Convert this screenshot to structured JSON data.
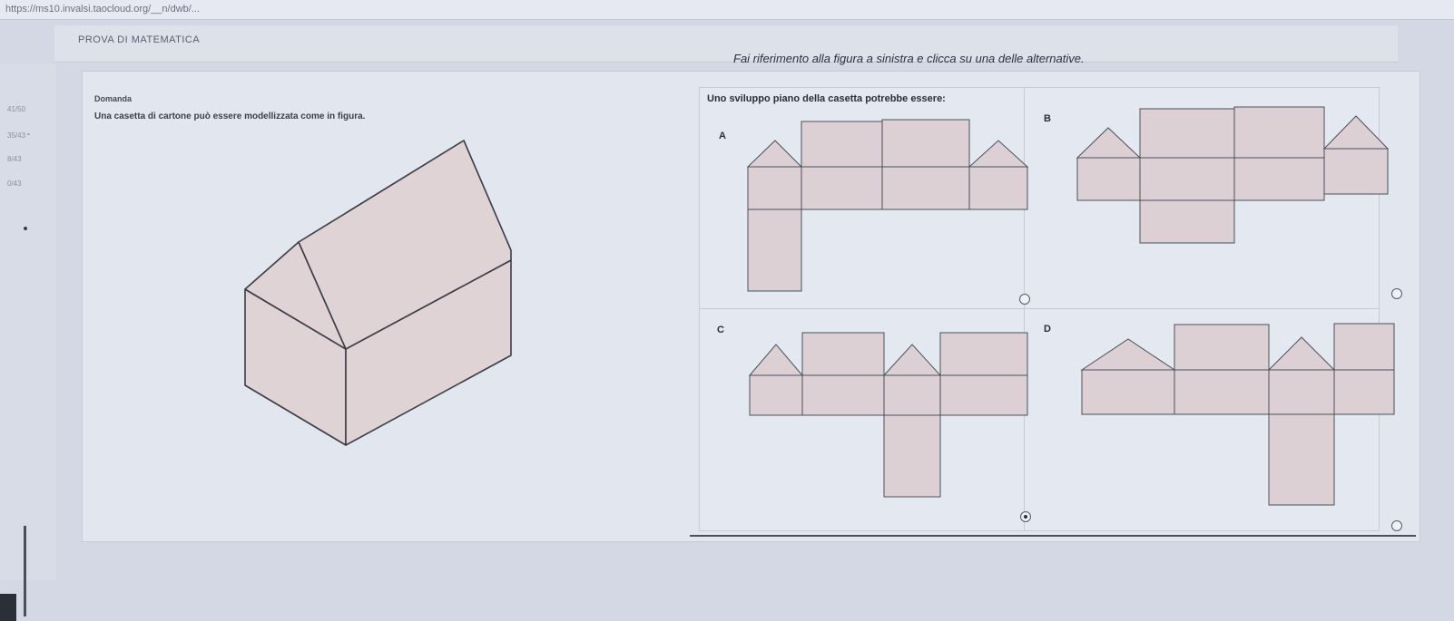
{
  "browser": {
    "url": "https://ms10.invalsi.taocloud.org/__n/dwb/..."
  },
  "header": {
    "title": "PROVA DI MATEMATICA"
  },
  "sidebar": {
    "items": [
      "41/50",
      "35/43",
      "8/43",
      "0/43"
    ]
  },
  "instruction": "Fai riferimento alla figura a sinistra e clicca su una delle alternative.",
  "question": {
    "label": "Domanda",
    "text": "Una casetta di cartone può essere modellizzata come in figura."
  },
  "options": {
    "prompt": "Uno sviluppo piano della casetta potrebbe essere:",
    "items": [
      {
        "letter": "A",
        "selected": false
      },
      {
        "letter": "B",
        "selected": false
      },
      {
        "letter": "C",
        "selected": true
      },
      {
        "letter": "D",
        "selected": false
      }
    ]
  },
  "colors": {
    "face_fill": "#dcd0d4",
    "stroke": "#4a4f5a",
    "background": "#d3d8e4"
  }
}
